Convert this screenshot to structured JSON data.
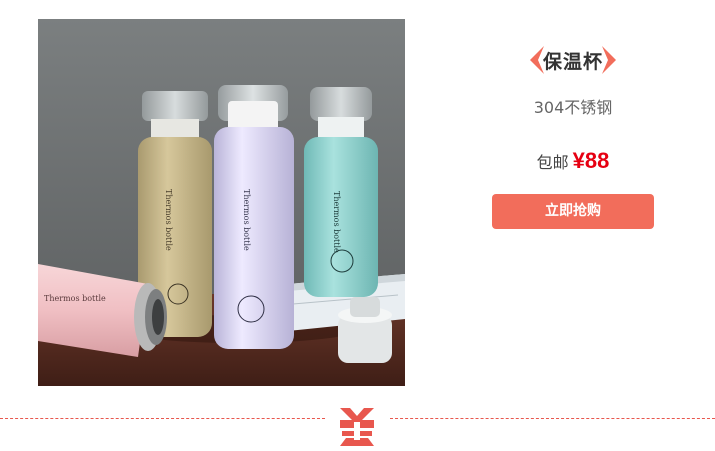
{
  "product": {
    "title": "保温杯",
    "subtitle": "304不锈钢",
    "shipping_label": "包邮",
    "price": "¥88",
    "buy_label": "立即抢购"
  },
  "photo": {
    "bottle_labels": [
      "Thermos bottle",
      "Thermos bottle",
      "Thermos bottle",
      "Thermos bottle"
    ],
    "colors": {
      "khaki": "#c9b98b",
      "lavender": "#d9d5ef",
      "mint": "#8fd0cd",
      "pink": "#f2c6c9",
      "table": "#5a2e22",
      "wall": "#6e7273"
    }
  },
  "theme": {
    "accent": "#f26d5b",
    "price_color": "#e60012",
    "divider_color": "#e8574e"
  }
}
